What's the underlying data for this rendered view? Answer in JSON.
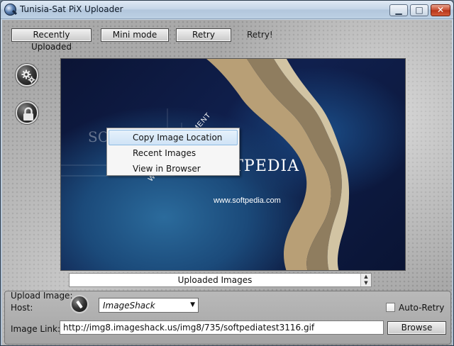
{
  "window": {
    "title": "Tunisia-Sat PiX Uploader",
    "minimize_glyph": "▁",
    "maximize_glyph": "□",
    "close_glyph": "✕"
  },
  "toolbar": {
    "recently_uploaded_label": "Recently Uploaded",
    "mini_mode_label": "Mini mode",
    "retry_label": "Retry",
    "retry_status": "Retry!"
  },
  "side_buttons": {
    "settings_icon": "gear-icon",
    "lock_icon": "lock-icon"
  },
  "preview": {
    "watermark_main": "SOFTPEDIA",
    "watermark_url": "www.softpedia.com",
    "watermark_ghost": "SOFT",
    "watermark_arc": "WEB   ENTERTAINMENT"
  },
  "context_menu": {
    "items": [
      {
        "label": "Copy Image Location",
        "highlighted": true
      },
      {
        "label": "Recent Images",
        "highlighted": false
      },
      {
        "label": "View in Browser",
        "highlighted": false
      }
    ]
  },
  "uploaded_images": {
    "label": "Uploaded Images",
    "up_glyph": "▲",
    "down_glyph": "▼"
  },
  "upload_group": {
    "title": "Upload Image:",
    "host_label": "Host:",
    "host_value": "ImageShack",
    "host_arrow": "▼",
    "auto_retry_label": "Auto-Retry",
    "auto_retry_checked": false,
    "image_link_label": "Image Link:",
    "image_link_value": "http://img8.imageshack.us/img8/735/softpediatest3116.gif",
    "browse_label": "Browse"
  },
  "colors": {
    "menu_highlight": "#cfe3f6",
    "close_button": "#c6472a",
    "image_background": "#10204e"
  }
}
